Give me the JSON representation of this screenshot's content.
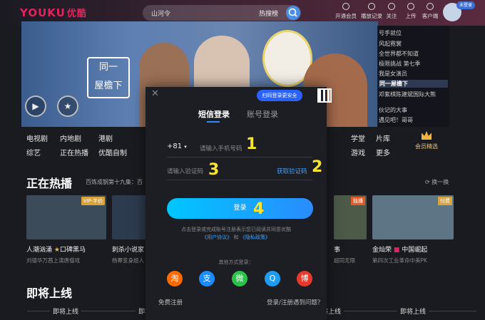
{
  "header": {
    "logo": "YOUKU",
    "logo_cn": "优酷",
    "search_query": "山河令",
    "search_hot": "热搜榜",
    "nav": [
      "开通会员",
      "播放记录",
      "关注",
      "上传",
      "客户端"
    ],
    "avatar_badge": "未登录"
  },
  "banner": {
    "title_line1": "同一",
    "title_line2": "屋檐下",
    "tag": "同一屋檐下"
  },
  "sidebar_list": [
    "号手就位",
    "风起霓裳",
    "全世界都不知道",
    "极限挑战 第七季",
    "我是女演员",
    "同一屋檐下",
    "邓紫棋陈建斌国际大熊",
    "伙记的大事",
    "遇见吧！哥哥"
  ],
  "category_nav": {
    "row1": [
      "电视剧",
      "内地剧",
      "港剧"
    ],
    "row2": [
      "综艺",
      "正在热播",
      "优酷自制"
    ],
    "right_row1": [
      "学堂",
      "片库"
    ],
    "right_row2": [
      "游戏",
      "更多"
    ],
    "vip": "会员精选"
  },
  "hot_section": {
    "title": "正在热播",
    "subtitle": "百炼成钢第十九集：百",
    "refresh": "换一换",
    "cards": [
      {
        "title": "人潮汹涌",
        "badge": "VIP·半价",
        "tag": "口碑黑马",
        "desc": "刘德华万茜上演唐僧戏",
        "color": "#3c4b5a"
      },
      {
        "title": "刺杀小说家",
        "desc": "杨幂变身超人",
        "color": "#2c3b4e"
      },
      {
        "title": "事",
        "desc": "超同无限",
        "color": "#4d5a48",
        "badge": "独播"
      },
      {
        "title": "金灿荣",
        "tag": "中国崛起",
        "desc": "第四次工业革命中美PK",
        "color": "#5d7585",
        "badge": "付费"
      }
    ]
  },
  "upcoming": {
    "title": "即将上线",
    "items": [
      "即将上线",
      "即将上线",
      "即将上线",
      "即将上线",
      "即将上线"
    ]
  },
  "modal": {
    "qr_tag": "扫码登录更安全",
    "tab_sms": "短信登录",
    "tab_account": "账号登录",
    "country_code": "+81",
    "phone_placeholder": "请输入手机号码",
    "code_placeholder": "请输入验证码",
    "get_code": "获取验证码",
    "login": "登录",
    "agree_text": "点击登录或完成账号注册表示您已阅读并同意优酷",
    "user_agreement": "《用户协议》",
    "and": "和",
    "privacy": "《隐私政策》",
    "other_login": "其他方式登录：",
    "social": [
      {
        "glyph": "淘",
        "color": "#ff6a00"
      },
      {
        "glyph": "支",
        "color": "#1a8cff"
      },
      {
        "glyph": "微",
        "color": "#29c349"
      },
      {
        "glyph": "Q",
        "color": "#1e9bf3"
      },
      {
        "glyph": "博",
        "color": "#e6392c"
      }
    ],
    "register": "免费注册",
    "problem": "登录/注册遇到问题？"
  },
  "annotations": [
    "1",
    "2",
    "3",
    "4"
  ]
}
